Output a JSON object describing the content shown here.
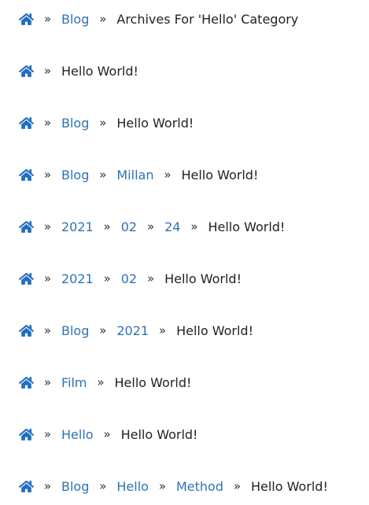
{
  "colors": {
    "link": "#2f72b5",
    "icon": "#1f6fc0",
    "text": "#222222"
  },
  "icons": {
    "home": "home-icon",
    "separator": "»"
  },
  "breadcrumbs": [
    {
      "links": [
        "Blog"
      ],
      "current": "Archives For 'Hello' Category"
    },
    {
      "links": [],
      "current": "Hello World!"
    },
    {
      "links": [
        "Blog"
      ],
      "current": "Hello World!"
    },
    {
      "links": [
        "Blog",
        "Millan"
      ],
      "current": "Hello World!"
    },
    {
      "links": [
        "2021",
        "02",
        "24"
      ],
      "current": "Hello World!"
    },
    {
      "links": [
        "2021",
        "02"
      ],
      "current": "Hello World!"
    },
    {
      "links": [
        "Blog",
        "2021"
      ],
      "current": "Hello World!"
    },
    {
      "links": [
        "Film"
      ],
      "current": "Hello World!"
    },
    {
      "links": [
        "Hello"
      ],
      "current": "Hello World!"
    },
    {
      "links": [
        "Blog",
        "Hello",
        "Method"
      ],
      "current": "Hello World!"
    }
  ]
}
